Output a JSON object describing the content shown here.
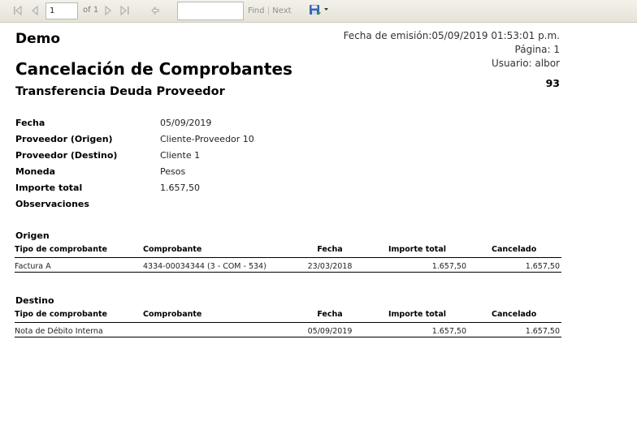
{
  "toolbar": {
    "page_value": "1",
    "of_pages": "of 1",
    "search_value": "",
    "find_label": "Find",
    "separator": "|",
    "next_label": "Next",
    "icons": [
      "first-page-icon",
      "prev-page-icon",
      "next-page-icon",
      "last-page-icon",
      "back-icon",
      "save-export-icon",
      "dropdown-arrow-icon"
    ]
  },
  "report": {
    "company": "Demo",
    "title": "Cancelación de Comprobantes",
    "subtitle": "Transferencia Deuda Proveedor",
    "issue_date": "Fecha de emisión:05/09/2019 01:53:01 p.m.",
    "page": "Página: 1",
    "user": "Usuario: albor",
    "number": "93",
    "fields": [
      {
        "label": "Fecha",
        "value": "05/09/2019"
      },
      {
        "label": "Proveedor (Origen)",
        "value": "Cliente-Proveedor 10"
      },
      {
        "label": "Proveedor (Destino)",
        "value": "Cliente 1"
      },
      {
        "label": "Moneda",
        "value": "Pesos"
      },
      {
        "label": "Importe total",
        "value": "1.657,50"
      },
      {
        "label": "Observaciones",
        "value": ""
      }
    ],
    "columns": [
      "Tipo de comprobante",
      "Comprobante",
      "Fecha",
      "Importe total",
      "Cancelado"
    ],
    "origen": {
      "title": "Origen",
      "rows": [
        {
          "tipo": "Factura A",
          "comprobante": "4334-00034344 (3 - COM - 534)",
          "fecha": "23/03/2018",
          "importe": "1.657,50",
          "cancelado": "1.657,50"
        }
      ]
    },
    "destino": {
      "title": "Destino",
      "rows": [
        {
          "tipo": "Nota de Débito Interna",
          "comprobante": "",
          "fecha": "05/09/2019",
          "importe": "1.657,50",
          "cancelado": "1.657,50"
        }
      ]
    }
  }
}
